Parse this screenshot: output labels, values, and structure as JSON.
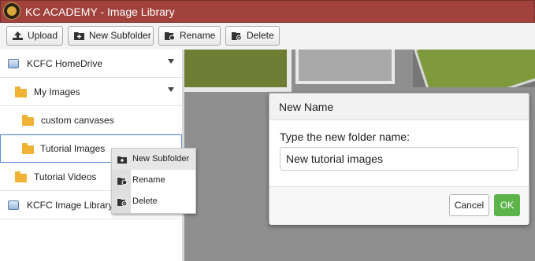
{
  "window": {
    "title": "KC ACADEMY - Image Library",
    "logo_icon": "kc-academy-logo",
    "title_bar_color": "#a1423c"
  },
  "toolbar": {
    "buttons": [
      {
        "label": "Upload",
        "icon": "upload-icon"
      },
      {
        "label": "New Subfolder",
        "icon": "new-folder-icon"
      },
      {
        "label": "Rename",
        "icon": "rename-icon"
      },
      {
        "label": "Delete",
        "icon": "delete-icon"
      }
    ]
  },
  "sidebar": {
    "items": [
      {
        "label": "KCFC HomeDrive",
        "icon": "drive-icon",
        "expandable": true
      },
      {
        "label": "My Images",
        "icon": "folder-icon",
        "expandable": true
      },
      {
        "label": "custom canvases",
        "icon": "folder-icon"
      },
      {
        "label": "Tutorial Images",
        "icon": "folder-icon",
        "selected": true
      },
      {
        "label": "Tutorial Videos",
        "icon": "folder-icon"
      },
      {
        "label": "KCFC Image Library",
        "icon": "drive-icon"
      }
    ]
  },
  "context_menu": {
    "items": [
      {
        "label": "New Subfolder",
        "icon": "new-folder-icon",
        "highlighted": true
      },
      {
        "label": "Rename",
        "icon": "rename-icon"
      },
      {
        "label": "Delete",
        "icon": "delete-icon"
      }
    ]
  },
  "dialog": {
    "title": "New Name",
    "prompt": "Type the new folder name:",
    "input_value": "New tutorial images",
    "cancel_label": "Cancel",
    "ok_label": "OK",
    "ok_color": "#5cb44a"
  }
}
